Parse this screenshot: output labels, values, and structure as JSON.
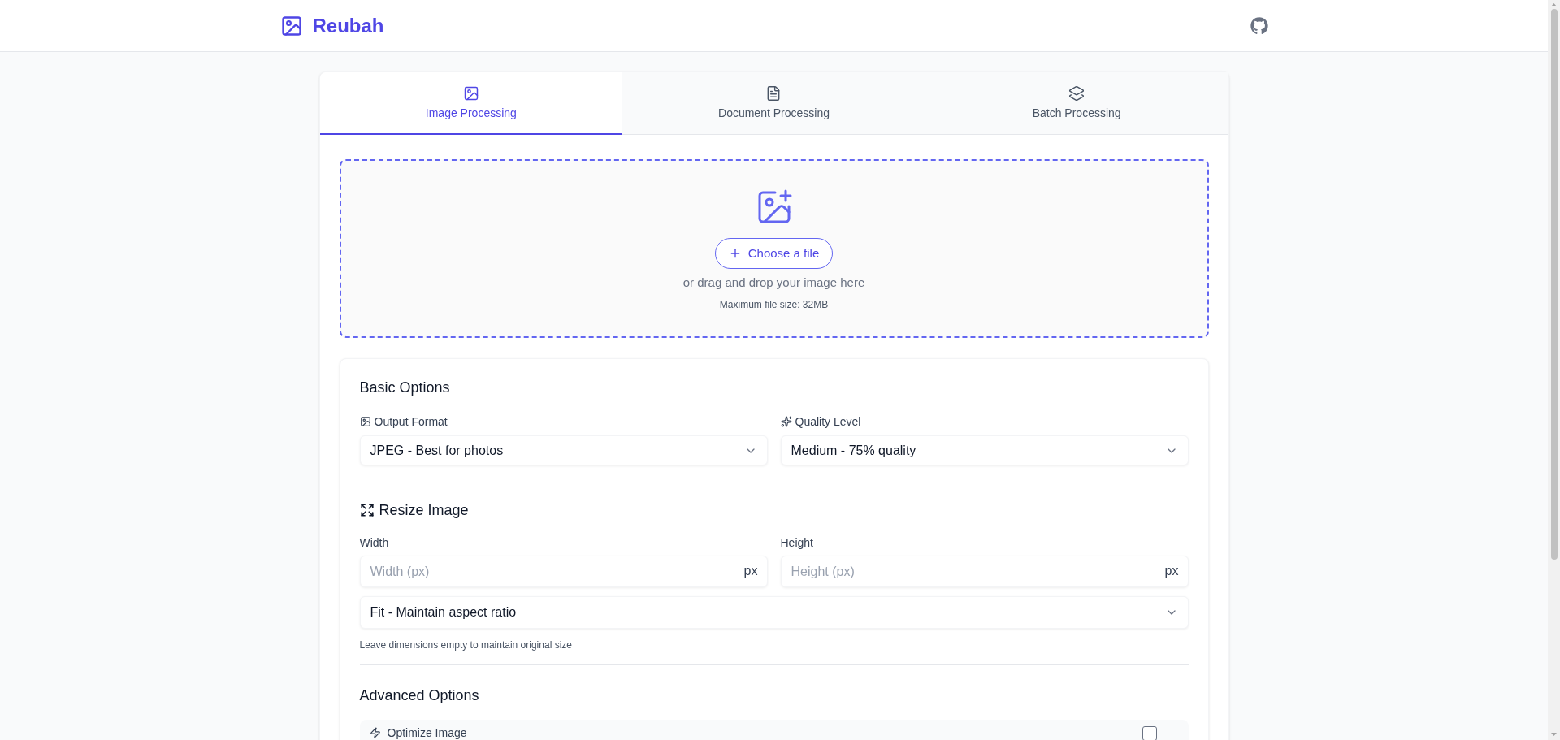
{
  "header": {
    "brand": "Reubah"
  },
  "tabs": [
    {
      "label": "Image Processing",
      "selected": true,
      "kind": "image"
    },
    {
      "label": "Document Processing",
      "selected": false,
      "kind": "document"
    },
    {
      "label": "Batch Processing",
      "selected": false,
      "kind": "batch"
    }
  ],
  "upload": {
    "button": "Choose a file",
    "hint": "or drag and drop your image here",
    "limit": "Maximum file size: 32MB"
  },
  "basic_options": {
    "title": "Basic Options",
    "fields": [
      {
        "label": "Output Format",
        "value": "JPEG - Best for photos",
        "kind": "format"
      },
      {
        "label": "Quality Level",
        "value": "Medium - 75% quality",
        "kind": "quality"
      }
    ]
  },
  "resize": {
    "title": "Resize Image",
    "fields": [
      {
        "label": "Width",
        "placeholder": "Width (px)",
        "unit": "px"
      },
      {
        "label": "Height",
        "placeholder": "Height (px)",
        "unit": "px"
      }
    ],
    "mode": "Fit - Maintain aspect ratio",
    "note": "Leave dimensions empty to maintain original size"
  },
  "advanced_options": {
    "title": "Advanced Options",
    "items": [
      {
        "label": "Optimize Image",
        "checked": false
      }
    ]
  }
}
